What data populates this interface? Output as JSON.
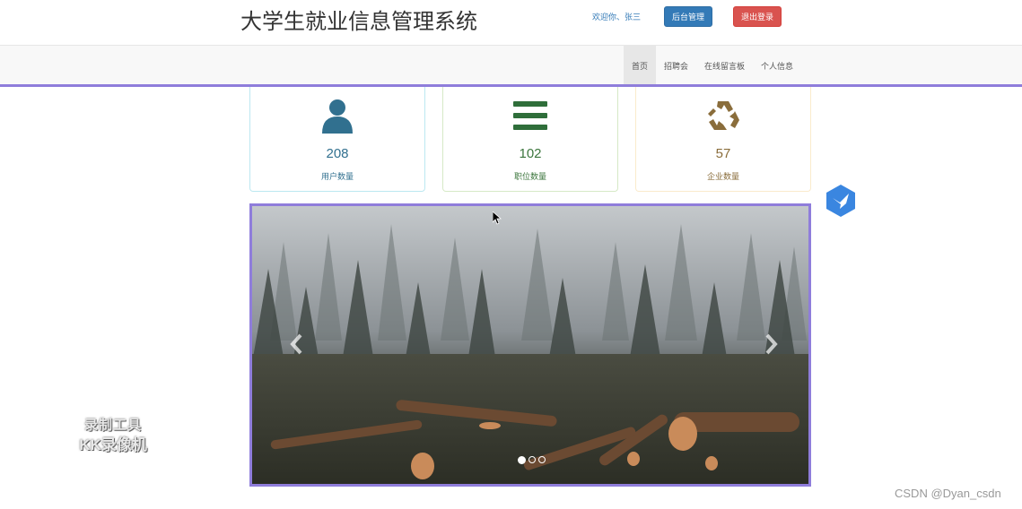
{
  "header": {
    "title": "大学生就业信息管理系统",
    "welcome": "欢迎你、张三",
    "admin_button": "后台管理",
    "logout_button": "退出登录"
  },
  "nav": {
    "items": [
      {
        "label": "首页",
        "active": true
      },
      {
        "label": "招聘会",
        "active": false
      },
      {
        "label": "在线留言板",
        "active": false
      },
      {
        "label": "个人信息",
        "active": false
      }
    ]
  },
  "stats": [
    {
      "icon": "user-icon",
      "value": "208",
      "label": "用户数量",
      "color": "#31708f"
    },
    {
      "icon": "list-icon",
      "value": "102",
      "label": "职位数量",
      "color": "#3c763d"
    },
    {
      "icon": "recycle-icon",
      "value": "57",
      "label": "企业数量",
      "color": "#8a6d3b"
    }
  ],
  "carousel": {
    "slide_count": 3,
    "active_index": 0,
    "prev_icon": "chevron-left-icon",
    "next_icon": "chevron-right-icon"
  },
  "watermarks": {
    "recorder_line1": "录制工具",
    "recorder_line2": "KK录像机",
    "csdn": "CSDN @Dyan_csdn"
  },
  "colors": {
    "accent_line": "#8f7ddb",
    "primary": "#337ab7",
    "danger": "#d9534f"
  }
}
